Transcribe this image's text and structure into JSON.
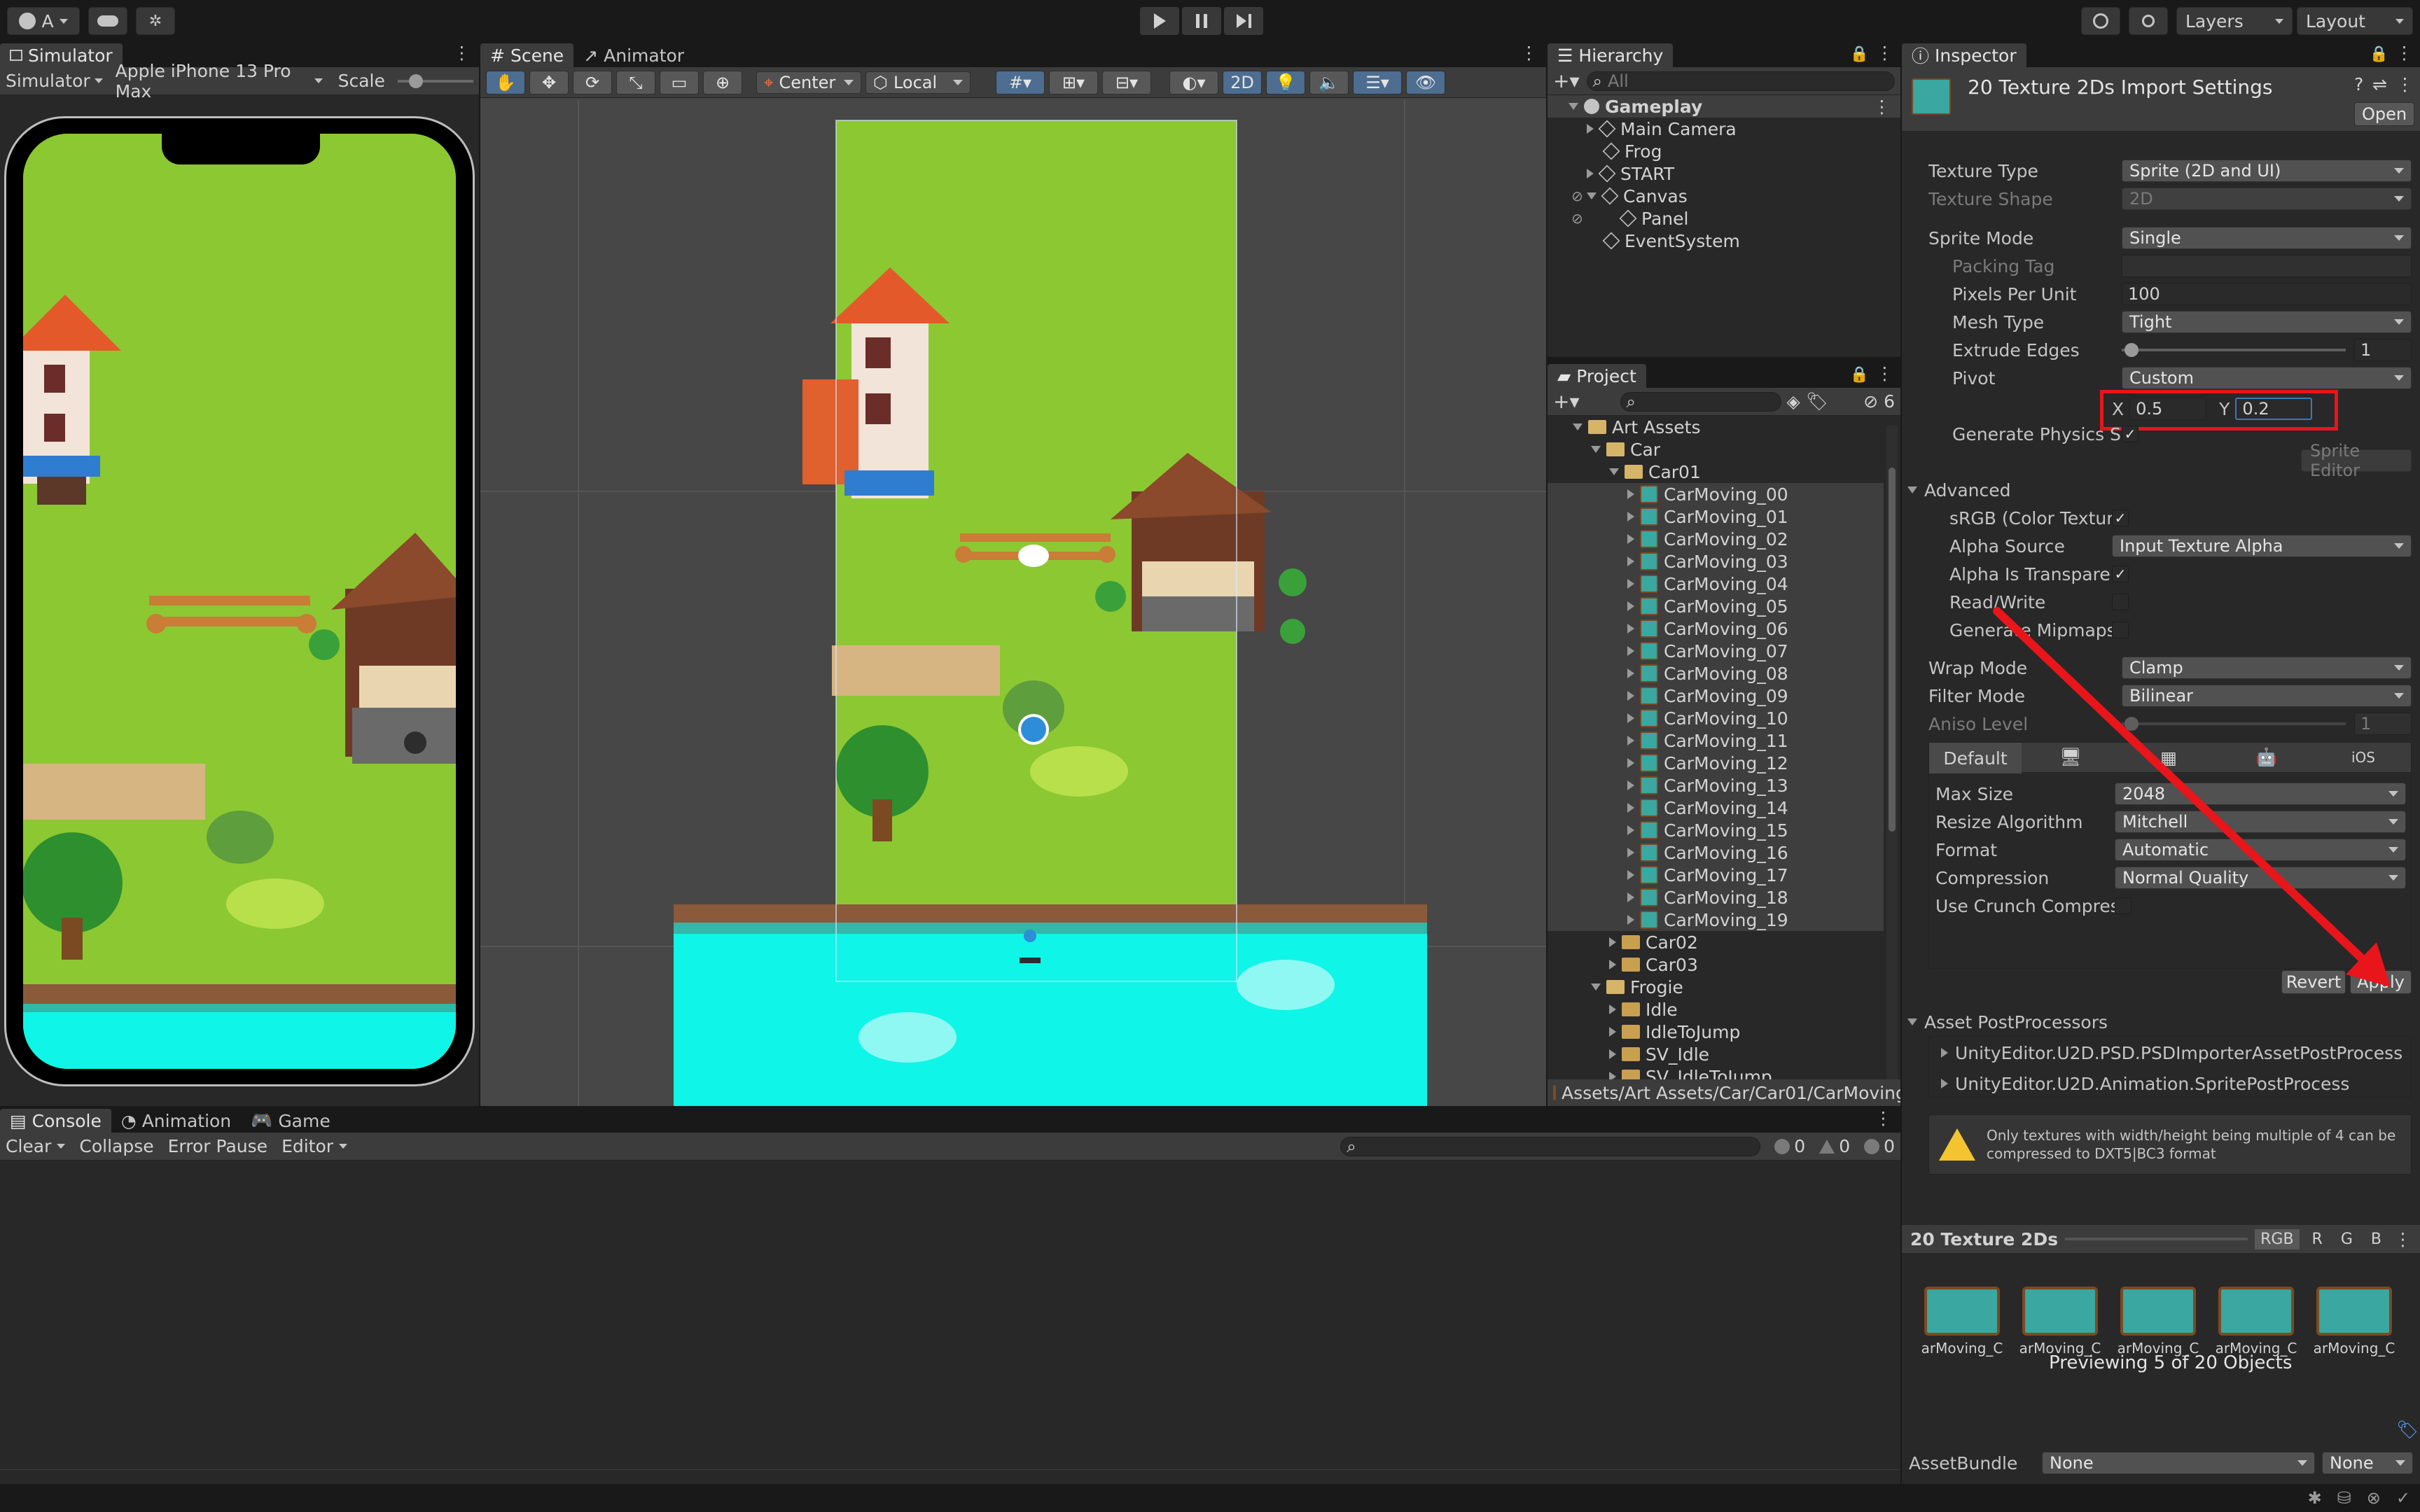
{
  "toolbar": {
    "account_label": "A",
    "layers_label": "Layers",
    "layout_label": "Layout"
  },
  "simulator": {
    "tab": "Simulator",
    "mode": "Simulator",
    "device": "Apple iPhone 13 Pro Max",
    "scale_label": "Scale"
  },
  "scene": {
    "tab_scene": "Scene",
    "tab_animator": "Animator",
    "pivot_mode": "Center",
    "space_mode": "Local",
    "mode_2d": "2D"
  },
  "hierarchy": {
    "tab": "Hierarchy",
    "search_placeholder": "All",
    "root": "Gameplay",
    "items": [
      "Main Camera",
      "Frog",
      "START",
      "Canvas",
      "Panel",
      "EventSystem"
    ]
  },
  "project": {
    "tab": "Project",
    "hidden_count": "6",
    "folders": {
      "art_assets": "Art Assets",
      "car": "Car",
      "car01": "Car01",
      "car02": "Car02",
      "car03": "Car03",
      "frogie": "Frogie"
    },
    "car_items": [
      "CarMoving_00",
      "CarMoving_01",
      "CarMoving_02",
      "CarMoving_03",
      "CarMoving_04",
      "CarMoving_05",
      "CarMoving_06",
      "CarMoving_07",
      "CarMoving_08",
      "CarMoving_09",
      "CarMoving_10",
      "CarMoving_11",
      "CarMoving_12",
      "CarMoving_13",
      "CarMoving_14",
      "CarMoving_15",
      "CarMoving_16",
      "CarMoving_17",
      "CarMoving_18",
      "CarMoving_19"
    ],
    "frogie_items": [
      "Idle",
      "IdleToJump",
      "SV_Idle",
      "SV_IdleToJump"
    ],
    "path": "Assets/Art Assets/Car/Car01/CarMoving"
  },
  "inspector": {
    "tab": "Inspector",
    "title": "20 Texture 2Ds Import Settings",
    "open_btn": "Open",
    "texture_type_label": "Texture Type",
    "texture_type": "Sprite (2D and UI)",
    "texture_shape_label": "Texture Shape",
    "texture_shape": "2D",
    "sprite_mode_label": "Sprite Mode",
    "sprite_mode": "Single",
    "packing_tag_label": "Packing Tag",
    "packing_tag": "",
    "ppu_label": "Pixels Per Unit",
    "ppu": "100",
    "mesh_type_label": "Mesh Type",
    "mesh_type": "Tight",
    "extrude_label": "Extrude Edges",
    "extrude": "1",
    "pivot_label": "Pivot",
    "pivot": "Custom",
    "pivot_x_label": "X",
    "pivot_x": "0.5",
    "pivot_y_label": "Y",
    "pivot_y": "0.2",
    "gen_physics_label": "Generate Physics S",
    "sprite_editor_btn": "Sprite Editor",
    "advanced_label": "Advanced",
    "srgb_label": "sRGB (Color Texture",
    "alpha_source_label": "Alpha Source",
    "alpha_source": "Input Texture Alpha",
    "alpha_transp_label": "Alpha Is Transparen",
    "read_write_label": "Read/Write",
    "gen_mipmaps_label": "Generate Mipmaps",
    "wrap_label": "Wrap Mode",
    "wrap": "Clamp",
    "filter_label": "Filter Mode",
    "filter": "Bilinear",
    "aniso_label": "Aniso Level",
    "aniso": "1",
    "platform_default": "Default",
    "platform_ios": "iOS",
    "max_size_label": "Max Size",
    "max_size": "2048",
    "resize_label": "Resize Algorithm",
    "resize": "Mitchell",
    "format_label": "Format",
    "format": "Automatic",
    "compression_label": "Compression",
    "compression": "Normal Quality",
    "crunch_label": "Use Crunch Compress",
    "revert_btn": "Revert",
    "apply_btn": "Apply",
    "postproc_label": "Asset PostProcessors",
    "postproc_items": [
      "UnityEditor.U2D.PSD.PSDImporterAssetPostProcessor",
      "UnityEditor.U2D.Animation.SpritePostProcess"
    ],
    "warning": "Only textures with width/height being multiple of 4 can be compressed to DXT5|BC3 format",
    "preview_title": "20 Texture 2Ds",
    "channels": [
      "RGB",
      "R",
      "G",
      "B"
    ],
    "thumb_label": "arMoving_C",
    "preview_caption": "Previewing 5 of 20 Objects",
    "assetbundle_label": "AssetBundle",
    "assetbundle": "None",
    "variant": "None"
  },
  "console": {
    "tab_console": "Console",
    "tab_animation": "Animation",
    "tab_game": "Game",
    "clear": "Clear",
    "collapse": "Collapse",
    "error_pause": "Error Pause",
    "editor": "Editor",
    "count_log": "0",
    "count_warn": "0",
    "count_err": "0"
  },
  "colors": {
    "grass": "#8cc832",
    "water": "#0ff5e8",
    "highlight_red": "#e8151b",
    "arrow_red": "#e8151b",
    "selection": "#2c5d87"
  }
}
